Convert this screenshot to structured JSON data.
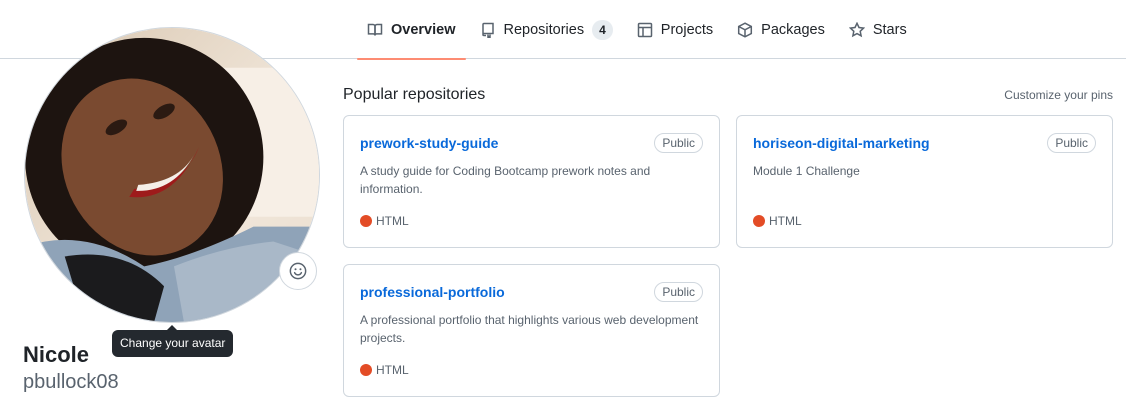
{
  "nav": {
    "tabs": [
      {
        "label": "Overview",
        "icon": "book-icon",
        "active": true
      },
      {
        "label": "Repositories",
        "icon": "repo-icon",
        "count": "4"
      },
      {
        "label": "Projects",
        "icon": "table-icon"
      },
      {
        "label": "Packages",
        "icon": "package-icon"
      },
      {
        "label": "Stars",
        "icon": "star-icon"
      }
    ]
  },
  "profile": {
    "name": "Nicole",
    "login": "pbullock08",
    "tooltip": "Change your avatar",
    "emoji_icon": "smiley-icon"
  },
  "pinned": {
    "title": "Popular repositories",
    "customize": "Customize your pins",
    "repos": [
      {
        "name": "prework-study-guide",
        "visibility": "Public",
        "description": "A study guide for Coding Bootcamp prework notes and information.",
        "language": "HTML",
        "language_color": "#e34c26"
      },
      {
        "name": "horiseon-digital-marketing",
        "visibility": "Public",
        "description": "Module 1 Challenge",
        "language": "HTML",
        "language_color": "#e34c26"
      },
      {
        "name": "professional-portfolio",
        "visibility": "Public",
        "description": "A professional portfolio that highlights various web development projects.",
        "language": "HTML",
        "language_color": "#e34c26"
      }
    ]
  },
  "colors": {
    "accent": "#fd8c73",
    "link": "#0969da"
  }
}
